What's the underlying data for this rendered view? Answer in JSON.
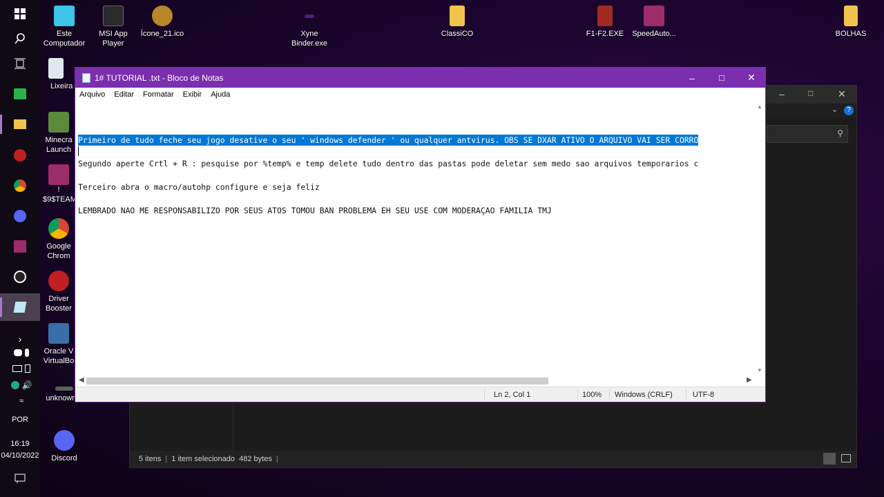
{
  "taskbar": {
    "language": "POR",
    "time": "16:19",
    "date": "04/10/2022"
  },
  "desktop_icons": [
    {
      "label": "Este\nComputador",
      "icon": "computer-icon",
      "color": "#3cc3e8"
    },
    {
      "label": "MSI App\nPlayer",
      "icon": "msi-app-player-icon",
      "color": "#2b2b2b"
    },
    {
      "label": "Ícone_21.ico",
      "icon": "ico-file-icon",
      "color": "#b8862b"
    },
    {
      "label": "Xyne\nBinder.exe",
      "icon": "xyne-binder-icon",
      "color": "#5a1a80"
    },
    {
      "label": "ClassiCO",
      "icon": "folder-icon",
      "color": "#f0c44c"
    },
    {
      "label": "F1-F2.EXE",
      "icon": "f1f2-exe-icon",
      "color": "#a02a20"
    },
    {
      "label": "SpeedAuto...",
      "icon": "winrar-icon",
      "color": "#9c2c6a"
    },
    {
      "label": "BOLHAS",
      "icon": "folder-icon",
      "color": "#f0c44c"
    },
    {
      "label": "Lixeira",
      "icon": "recycle-bin-icon",
      "color": "#dfe8ee"
    },
    {
      "label": "Minecra\nLaunch",
      "icon": "minecraft-icon",
      "color": "#5a8a3a"
    },
    {
      "label": "!\n$9$TEAM",
      "icon": "winrar-icon",
      "color": "#9c2c6a"
    },
    {
      "label": "Google\nChrom",
      "icon": "chrome-icon",
      "color": "#e8e8e8"
    },
    {
      "label": "Driver\nBooster",
      "icon": "driver-booster-icon",
      "color": "#c02020"
    },
    {
      "label": "Oracle V\nVirtualBo",
      "icon": "virtualbox-icon",
      "color": "#3a6ea8"
    },
    {
      "label": "unknown...",
      "icon": "unknown-file-icon",
      "color": "#556655"
    },
    {
      "label": "Discord",
      "icon": "discord-icon",
      "color": "#5865f2"
    }
  ],
  "explorer": {
    "status_items": "5 itens",
    "status_selected": "1 item selecionado  482 bytes"
  },
  "notepad": {
    "title": "1# TUTORIAL .txt - Bloco de Notas",
    "menu": [
      "Arquivo",
      "Editar",
      "Formatar",
      "Exibir",
      "Ajuda"
    ],
    "lines": [
      "Primeiro de tudo feche seu jogo desative o seu ' windows defender ' ou qualquer antvirus. OBS SE DXAR ATIVO O ARQUIVO VAI SER CORRO",
      "",
      "Segundo aperte Crtl + R : pesquise por %temp% e temp delete tudo dentro das pastas pode deletar sem medo sao arquivos temporarios c",
      "",
      "Terceiro abra o macro/autohp configure e seja feliz",
      "",
      "LEMBRADO NAO ME RESPONSABILIZO POR SEUS ATOS TOMOU BAN PROBLEMA EH SEU USE COM MODERAÇAO FAMILIA TMJ"
    ],
    "status": {
      "position": "Ln 2, Col 1",
      "zoom": "100%",
      "line_ending": "Windows (CRLF)",
      "encoding": "UTF-8"
    },
    "horizontal_scroll_fraction": 0.7
  }
}
